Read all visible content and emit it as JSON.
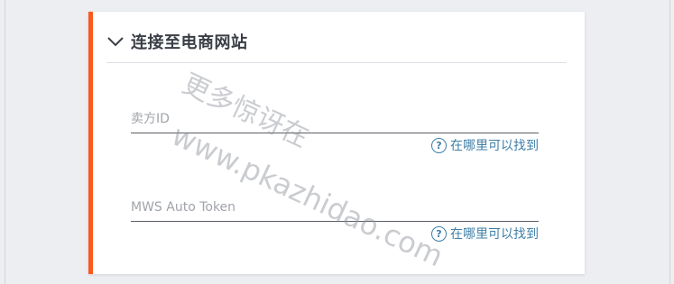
{
  "colors": {
    "accent": "#fa5a1e",
    "link": "#3f7fa8",
    "background": "#eceef2"
  },
  "section": {
    "title": "连接至电商网站",
    "toggle_icon": "chevron-down-icon"
  },
  "fields": [
    {
      "label": "卖方ID",
      "value": "",
      "help_text": "在哪里可以找到",
      "help_icon": "question-circle-icon"
    },
    {
      "label": "MWS Auto Token",
      "value": "",
      "help_text": "在哪里可以找到",
      "help_icon": "question-circle-icon"
    }
  ],
  "watermark": {
    "line1": "更多惊讶在",
    "line2": "www.pkazhidao.com"
  }
}
